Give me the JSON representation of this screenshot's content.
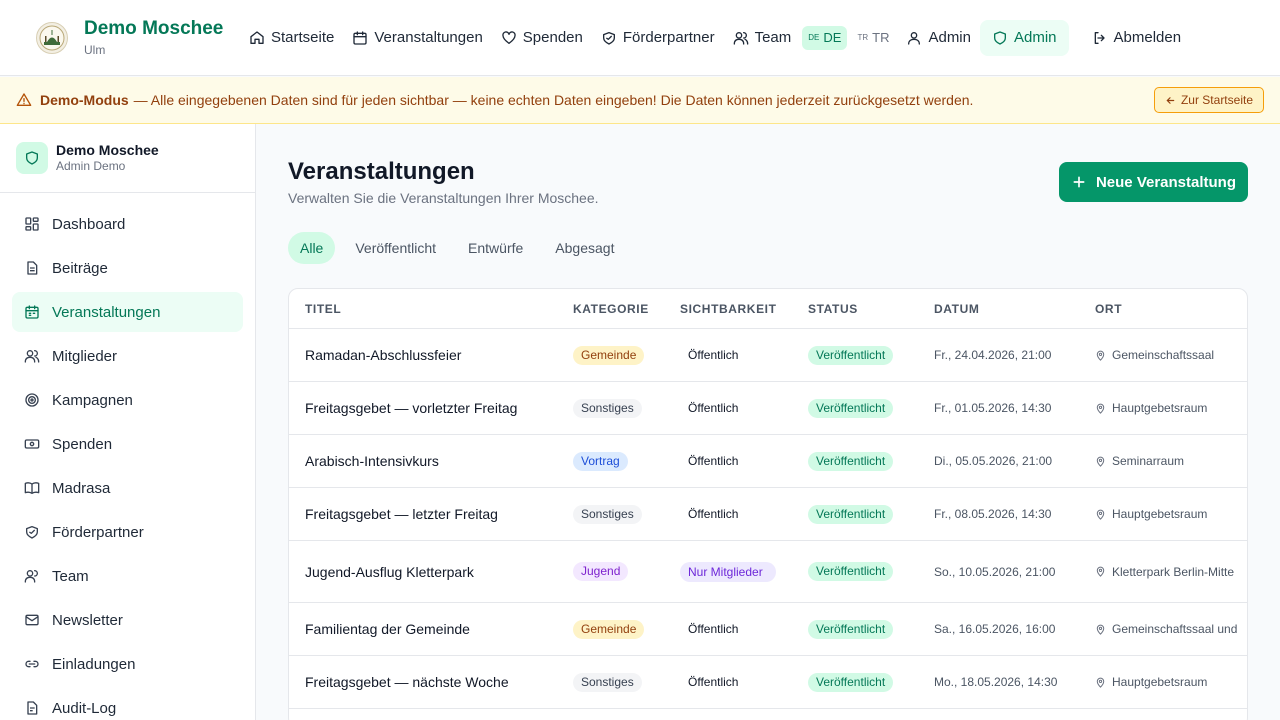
{
  "header": {
    "brand_name": "Demo Moschee",
    "brand_city": "Ulm",
    "nav": {
      "home": "Startseite",
      "events": "Veranstaltungen",
      "donations": "Spenden",
      "sponsors": "Förderpartner",
      "team": "Team",
      "lang_de_code": "DE",
      "lang_de": "DE",
      "lang_tr_code": "TR",
      "lang_tr": "TR",
      "admin_user": "Admin",
      "admin_panel": "Admin",
      "logout": "Abmelden"
    }
  },
  "banner": {
    "label": "Demo-Modus",
    "message": "— Alle eingegebenen Daten sind für jeden sichtbar — keine echten Daten eingeben! Die Daten können jederzeit zurückgesetzt werden.",
    "button": "Zur Startseite"
  },
  "sidebar": {
    "title": "Demo Moschee",
    "subtitle": "Admin Demo",
    "items": [
      {
        "label": "Dashboard",
        "icon": "dashboard-icon"
      },
      {
        "label": "Beiträge",
        "icon": "document-icon"
      },
      {
        "label": "Veranstaltungen",
        "icon": "calendar-icon",
        "active": true
      },
      {
        "label": "Mitglieder",
        "icon": "users-icon"
      },
      {
        "label": "Kampagnen",
        "icon": "target-icon"
      },
      {
        "label": "Spenden",
        "icon": "banknote-icon"
      },
      {
        "label": "Madrasa",
        "icon": "book-icon"
      },
      {
        "label": "Förderpartner",
        "icon": "handshake-icon"
      },
      {
        "label": "Team",
        "icon": "team-icon"
      },
      {
        "label": "Newsletter",
        "icon": "mail-icon"
      },
      {
        "label": "Einladungen",
        "icon": "link-icon"
      },
      {
        "label": "Audit-Log",
        "icon": "log-icon"
      }
    ]
  },
  "main": {
    "title": "Veranstaltungen",
    "subtitle": "Verwalten Sie die Veranstaltungen Ihrer Moschee.",
    "new_button": "Neue Veranstaltung",
    "tabs": [
      "Alle",
      "Veröffentlicht",
      "Entwürfe",
      "Abgesagt"
    ],
    "active_tab": "Alle",
    "columns": [
      "TITEL",
      "KATEGORIE",
      "SICHTBARKEIT",
      "STATUS",
      "DATUM",
      "ORT"
    ],
    "rows": [
      {
        "title": "Ramadan-Abschlussfeier",
        "category": "Gemeinde",
        "category_color": "amber",
        "visibility": "Öffentlich",
        "status": "Veröffentlicht",
        "date": "Fr., 24.04.2026, 21:00",
        "location": "Gemeinschaftssaal"
      },
      {
        "title": "Freitagsgebet — vorletzter Freitag",
        "category": "Sonstiges",
        "category_color": "gray",
        "visibility": "Öffentlich",
        "status": "Veröffentlicht",
        "date": "Fr., 01.05.2026, 14:30",
        "location": "Hauptgebetsraum"
      },
      {
        "title": "Arabisch-Intensivkurs",
        "category": "Vortrag",
        "category_color": "blue",
        "visibility": "Öffentlich",
        "status": "Veröffentlicht",
        "date": "Di., 05.05.2026, 21:00",
        "location": "Seminarraum"
      },
      {
        "title": "Freitagsgebet — letzter Freitag",
        "category": "Sonstiges",
        "category_color": "gray",
        "visibility": "Öffentlich",
        "status": "Veröffentlicht",
        "date": "Fr., 08.05.2026, 14:30",
        "location": "Hauptgebetsraum"
      },
      {
        "title": "Jugend-Ausflug Kletterpark",
        "category": "Jugend",
        "category_color": "purple",
        "visibility": "Nur Mitglieder",
        "status": "Veröffentlicht",
        "date": "So., 10.05.2026, 21:00",
        "location": "Kletterpark Berlin-Mitte"
      },
      {
        "title": "Familientag der Gemeinde",
        "category": "Gemeinde",
        "category_color": "amber",
        "visibility": "Öffentlich",
        "status": "Veröffentlicht",
        "date": "Sa., 16.05.2026, 16:00",
        "location": "Gemeinschaftssaal und"
      },
      {
        "title": "Freitagsgebet — nächste Woche",
        "category": "Sonstiges",
        "category_color": "gray",
        "visibility": "Öffentlich",
        "status": "Veröffentlicht",
        "date": "Mo., 18.05.2026, 14:30",
        "location": "Hauptgebetsraum"
      }
    ]
  },
  "colors": {
    "brand_green": "#047857",
    "primary_button": "#059669",
    "banner_bg": "#fefbe8",
    "banner_text": "#92400e"
  }
}
